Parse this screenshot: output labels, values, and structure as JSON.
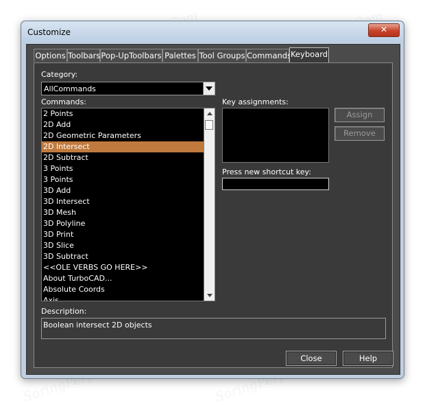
{
  "window": {
    "title": "Customize",
    "close_glyph": "✕"
  },
  "tabs": [
    {
      "label": "Options",
      "active": false
    },
    {
      "label": "Toolbars",
      "active": false
    },
    {
      "label": "Pop-UpToolbars",
      "active": false
    },
    {
      "label": "Palettes",
      "active": false
    },
    {
      "label": "Tool Groups",
      "active": false
    },
    {
      "label": "Commands",
      "active": false
    },
    {
      "label": "Keyboard",
      "active": true
    }
  ],
  "keyboard": {
    "category_label": "Category:",
    "category_value": "AllCommands",
    "commands_label": "Commands:",
    "commands": [
      "2 Points",
      "2D Add",
      " 2D Geometric Parameters",
      "2D Intersect",
      "2D Subtract",
      "3 Points",
      "3 Points",
      "3D Add",
      "3D Intersect",
      "3D Mesh",
      "3D Polyline",
      "3D Print",
      "3D Slice",
      "3D Subtract",
      "<<OLE VERBS GO HERE>>",
      "About TurboCAD...",
      "Absolute Coords",
      "Axis"
    ],
    "selected_command": "2D Intersect",
    "key_assignments_label": "Key assignments:",
    "shortcut_label": "Press new shortcut key:",
    "shortcut_value": "",
    "assign_label": "Assign",
    "remove_label": "Remove",
    "description_label": "Description:",
    "description_text": "Boolean intersect 2D objects"
  },
  "footer": {
    "close_label": "Close",
    "help_label": "Help"
  },
  "watermark": "SoringPerpair.Com",
  "colors": {
    "panel_bg": "#3a3a3a",
    "selection": "#c07a3e",
    "list_bg": "#000000"
  }
}
